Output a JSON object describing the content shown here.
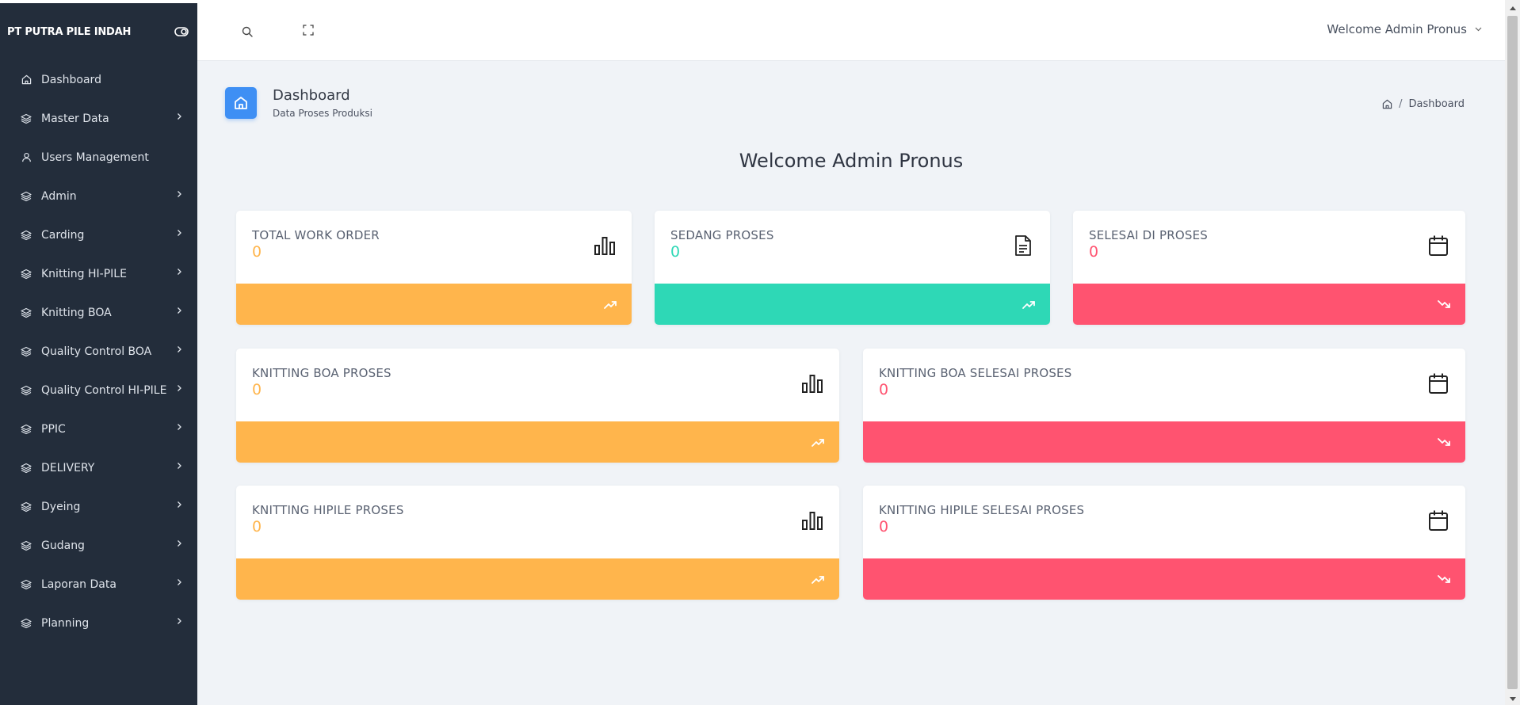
{
  "brand": {
    "name": "PT PUTRA PILE INDAH"
  },
  "sidebar": {
    "items": [
      {
        "label": "Dashboard",
        "icon": "home-icon",
        "has_children": false
      },
      {
        "label": "Master Data",
        "icon": "layers-icon",
        "has_children": true
      },
      {
        "label": "Users Management",
        "icon": "user-icon",
        "has_children": false
      },
      {
        "label": "Admin",
        "icon": "layers-icon",
        "has_children": true
      },
      {
        "label": "Carding",
        "icon": "layers-icon",
        "has_children": true
      },
      {
        "label": "Knitting HI-PILE",
        "icon": "layers-icon",
        "has_children": true
      },
      {
        "label": "Knitting BOA",
        "icon": "layers-icon",
        "has_children": true
      },
      {
        "label": "Quality Control BOA",
        "icon": "layers-icon",
        "has_children": true
      },
      {
        "label": "Quality Control HI-PILE",
        "icon": "layers-icon",
        "has_children": true
      },
      {
        "label": "PPIC",
        "icon": "layers-icon",
        "has_children": true
      },
      {
        "label": "DELIVERY",
        "icon": "layers-icon",
        "has_children": true
      },
      {
        "label": "Dyeing",
        "icon": "layers-icon",
        "has_children": true
      },
      {
        "label": "Gudang",
        "icon": "layers-icon",
        "has_children": true
      },
      {
        "label": "Laporan Data",
        "icon": "layers-icon",
        "has_children": true
      },
      {
        "label": "Planning",
        "icon": "layers-icon",
        "has_children": true
      }
    ]
  },
  "topbar": {
    "search_icon": "search-icon",
    "fullscreen_icon": "fullscreen-icon",
    "user_label": "Welcome Admin Pronus"
  },
  "page": {
    "title": "Dashboard",
    "subtitle": "Data Proses Produksi",
    "breadcrumb_current": "Dashboard",
    "welcome": "Welcome Admin Pronus"
  },
  "colors": {
    "orange": "#ffb54c",
    "teal": "#2ed8b6",
    "red": "#ff5370",
    "sidebar": "#232d3b",
    "accent": "#3e8ff4"
  },
  "cards": [
    {
      "title": "TOTAL WORK ORDER",
      "value": "0",
      "color": "#ffb54c",
      "icon": "bar-chart-icon",
      "trend": "trending-up-icon"
    },
    {
      "title": "SEDANG PROSES",
      "value": "0",
      "color": "#2ed8b6",
      "icon": "document-icon",
      "trend": "trending-up-icon"
    },
    {
      "title": "SELESAI DI PROSES",
      "value": "0",
      "color": "#ff5370",
      "icon": "calendar-icon",
      "trend": "trending-down-icon"
    },
    {
      "title": "KNITTING BOA PROSES",
      "value": "0",
      "color": "#ffb54c",
      "icon": "bar-chart-icon",
      "trend": "trending-up-icon"
    },
    {
      "title": "KNITTING BOA SELESAI PROSES",
      "value": "0",
      "color": "#ff5370",
      "icon": "calendar-icon",
      "trend": "trending-down-icon"
    },
    {
      "title": "KNITTING HIPILE PROSES",
      "value": "0",
      "color": "#ffb54c",
      "icon": "bar-chart-icon",
      "trend": "trending-up-icon"
    },
    {
      "title": "KNITTING HIPILE SELESAI PROSES",
      "value": "0",
      "color": "#ff5370",
      "icon": "calendar-icon",
      "trend": "trending-down-icon"
    }
  ]
}
